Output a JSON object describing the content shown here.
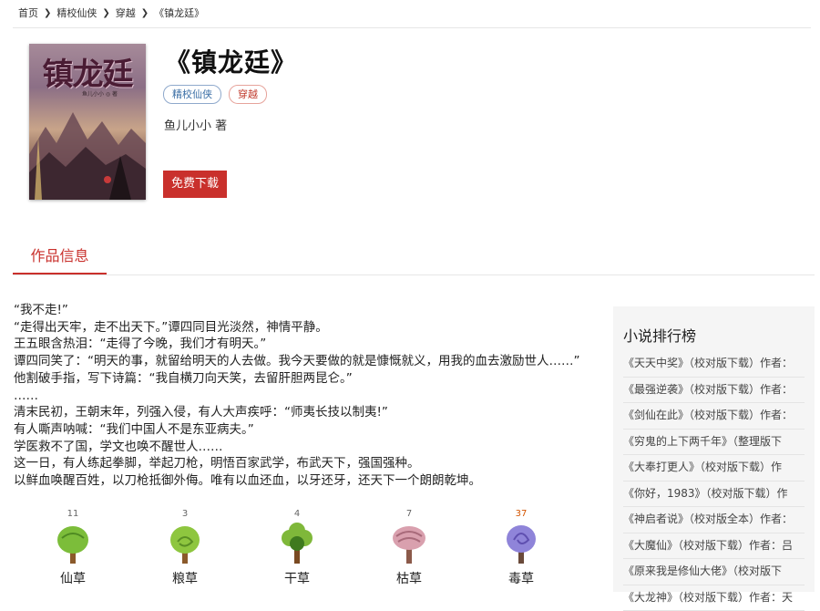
{
  "breadcrumb": [
    "首页",
    "精校仙侠",
    "穿越",
    "《镇龙廷》"
  ],
  "book": {
    "title": "《镇龙廷》",
    "cover_title": "镇龙廷",
    "cover_author": "鱼儿小小 ◎ 著",
    "tags": [
      "精校仙侠",
      "穿越"
    ],
    "author": "鱼儿小小 著",
    "download_label": "免费下载"
  },
  "tabs": {
    "active": "作品信息"
  },
  "intro": [
    "“我不走!”",
    "“走得出天牢，走不出天下。”谭四同目光淡然，神情平静。",
    "王五眼含热泪：“走得了今晚，我们才有明天。”",
    "谭四同笑了：“明天的事，就留给明天的人去做。我今天要做的就是慷慨就义，用我的血去激励世人……”",
    "他割破手指，写下诗篇：“我自横刀向天笑，去留肝胆两昆仑。”",
    "……",
    "清末民初，王朝末年，列强入侵，有人大声疾呼：“师夷长技以制夷!”",
    "有人嘶声呐喊：“我们中国人不是东亚病夫。”",
    "学医救不了国，学文也唤不醒世人……",
    "这一日，有人练起拳脚，举起刀枪，明悟百家武学，布武天下，强国强种。",
    "以鲜血唤醒百姓，以刀枪抵御外侮。唯有以血还血，以牙还牙，还天下一个朗朗乾坤。"
  ],
  "ratings": [
    {
      "label": "仙草",
      "count": "11",
      "leaf": "#7cbd3a",
      "dark": "#4e8a22",
      "trunk": "#8b5a2b"
    },
    {
      "label": "粮草",
      "count": "3",
      "leaf": "#8ec63f",
      "dark": "#5a8f25",
      "trunk": "#8b5a2b"
    },
    {
      "label": "干草",
      "count": "4",
      "leaf": "#7fb83a",
      "dark": "#3f7a1f",
      "trunk": "#7a4a22"
    },
    {
      "label": "枯草",
      "count": "7",
      "leaf": "#d9a0ae",
      "dark": "#a86a7a",
      "trunk": "#8b5a4a"
    },
    {
      "label": "毒草",
      "count": "37",
      "leaf": "#8f84d9",
      "dark": "#5f4fb0",
      "trunk": "#6a4a3a"
    }
  ],
  "sidebar": {
    "title": "小说排行榜",
    "items": [
      "《天天中奖》（校对版下载）作者：",
      "《最强逆袭》（校对版下载）作者：",
      "《剑仙在此》（校对版下载）作者：",
      "《穷鬼的上下两千年》（整理版下",
      "《大奉打更人》（校对版下载）作",
      "《你好，1983》（校对版下载）作",
      "《神启者说》（校对版全本）作者：",
      "《大魔仙》（校对版下载）作者：吕",
      "《原来我是修仙大佬》（校对版下",
      "《大龙神》（校对版下载）作者：天"
    ]
  },
  "colors": {
    "accent": "#c9302c",
    "tag_blue": "#3a6ea5",
    "tag_red": "#c0392b",
    "sidebar_bg": "#f5f5f5"
  },
  "icons": [
    "chevron-right-icon",
    "tree-icon"
  ]
}
